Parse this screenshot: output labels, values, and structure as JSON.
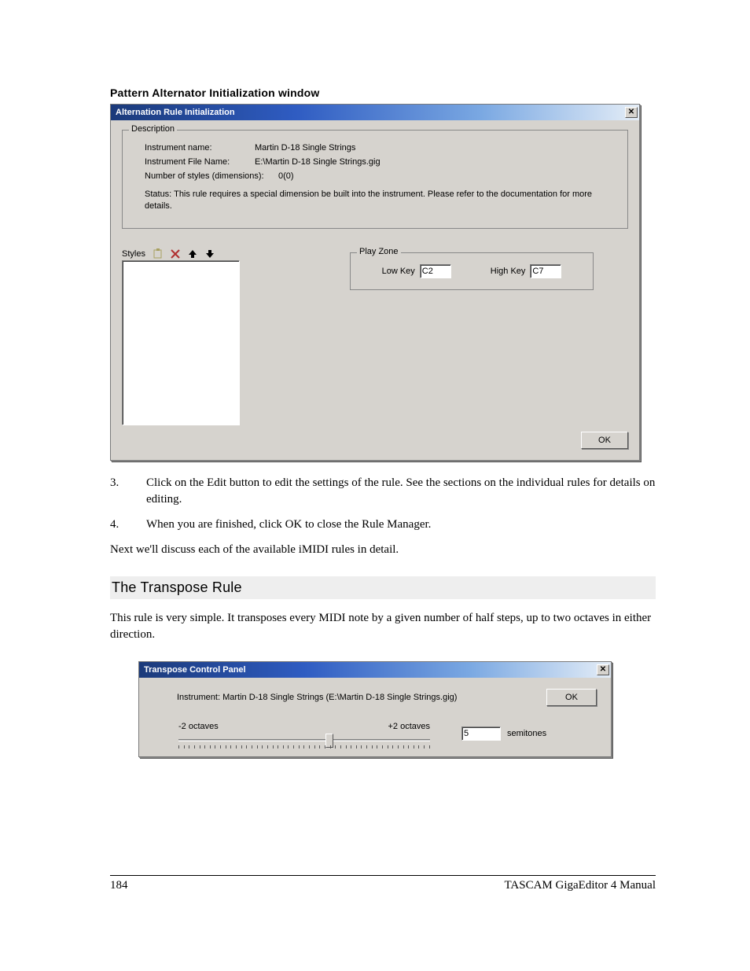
{
  "caption": "Pattern Alternator Initialization window",
  "win1": {
    "title": "Alternation Rule Initialization",
    "close_glyph": "✕",
    "group_desc_legend": "Description",
    "instr_name_label": "Instrument name:",
    "instr_name_value": "Martin D-18 Single Strings",
    "instr_file_label": "Instrument File Name:",
    "instr_file_value": "E:\\Martin D-18 Single Strings.gig",
    "numstyles_label": "Number of styles (dimensions):",
    "numstyles_value": "0(0)",
    "status_text": "Status: This rule requires a special dimension be built into the instrument. Please refer to the documentation for more details.",
    "styles_label": "Styles",
    "playzone_legend": "Play Zone",
    "lowkey_label": "Low Key",
    "lowkey_value": "C2",
    "highkey_label": "High Key",
    "highkey_value": "C7",
    "ok_label": "OK"
  },
  "body": {
    "step3_num": "3.",
    "step3": "Click on the Edit button to edit the settings of the rule.  See the sections on the individual rules for details on editing.",
    "step4_num": "4.",
    "step4": "When you are finished, click OK to close the Rule Manager.",
    "nextline": "Next we'll discuss each of the available iMIDI rules in detail.",
    "section": "The Transpose Rule",
    "sectpara": "This rule is very simple.  It transposes every MIDI note by a given number of half steps, up to two octaves in either direction."
  },
  "win2": {
    "title": "Transpose Control Panel",
    "close_glyph": "✕",
    "instr_line": "Instrument: Martin D-18 Single Strings (E:\\Martin D-18 Single Strings.gig)",
    "ok_label": "OK",
    "left_label": "-2 octaves",
    "right_label": "+2 octaves",
    "semitones_value": "5",
    "semitones_label": "semitones"
  },
  "chart_data": {
    "type": "slider",
    "min": -24,
    "max": 24,
    "value": 5,
    "unit": "semitones",
    "left_end_label": "-2 octaves",
    "right_end_label": "+2 octaves"
  },
  "footer": {
    "page": "184",
    "book": "TASCAM GigaEditor 4 Manual"
  }
}
